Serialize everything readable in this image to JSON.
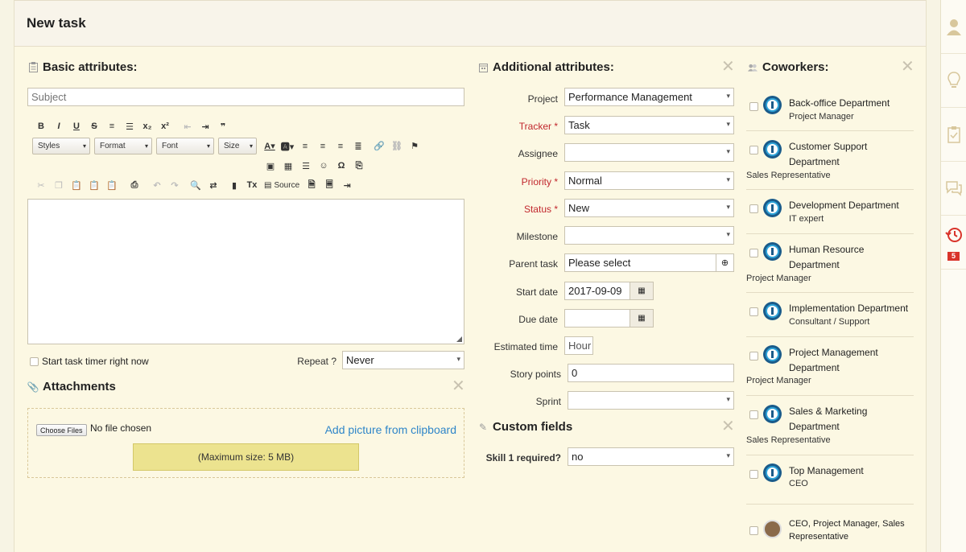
{
  "header": {
    "title": "New task"
  },
  "basic": {
    "title": "Basic attributes:",
    "subject_placeholder": "Subject",
    "toolbar": {
      "styles": "Styles",
      "format": "Format",
      "font": "Font",
      "size": "Size",
      "source": "Source"
    },
    "timer_label": "Start task timer right now",
    "repeat_label": "Repeat ?",
    "repeat_value": "Never"
  },
  "attachments": {
    "title": "Attachments",
    "choose_files": "Choose Files",
    "no_file": "No file chosen",
    "clipboard_link": "Add picture from clipboard",
    "max_size": "(Maximum size: 5 MB)"
  },
  "additional": {
    "title": "Additional attributes:",
    "fields": [
      {
        "label": "Project",
        "value": "Performance Management",
        "required": false
      },
      {
        "label": "Tracker *",
        "value": "Task",
        "required": true
      },
      {
        "label": "Assignee",
        "value": "",
        "required": false
      },
      {
        "label": "Priority *",
        "value": "Normal",
        "required": true
      },
      {
        "label": "Status *",
        "value": "New",
        "required": true
      },
      {
        "label": "Milestone",
        "value": "",
        "required": false
      },
      {
        "label": "Parent task",
        "value": "Please select",
        "required": false
      },
      {
        "label": "Start date",
        "value": "2017-09-09",
        "required": false
      },
      {
        "label": "Due date",
        "value": "",
        "required": false
      },
      {
        "label": "Estimated time",
        "value": "Hour",
        "required": false
      },
      {
        "label": "Story points",
        "value": "0",
        "required": false
      },
      {
        "label": "Sprint",
        "value": "",
        "required": false
      }
    ]
  },
  "custom": {
    "title": "Custom fields",
    "skill_label": "Skill 1 required?",
    "skill_value": "no"
  },
  "coworkers": {
    "title": "Coworkers:",
    "items": [
      {
        "name": "Back-office Department",
        "role": "Project Manager"
      },
      {
        "name": "Customer Support Department",
        "role": "Sales Representative"
      },
      {
        "name": "Development Department",
        "role": "IT expert"
      },
      {
        "name": "Human Resource Department",
        "role": "Project Manager"
      },
      {
        "name": "Implementation Department",
        "role": "Consultant / Support"
      },
      {
        "name": "Project Management Department",
        "role": "Project Manager"
      },
      {
        "name": "Sales & Marketing Department",
        "role": "Sales Representative"
      },
      {
        "name": "Top Management",
        "role": "CEO"
      },
      {
        "name": "CEO, Project Manager, Sales Representative",
        "role": ""
      }
    ]
  },
  "rail": {
    "badge": "5"
  },
  "colors": {
    "accent_link": "#2f86c9",
    "required_red": "#c1272d",
    "badge_red": "#d9342b",
    "highlight_yellow": "#ece38f"
  }
}
